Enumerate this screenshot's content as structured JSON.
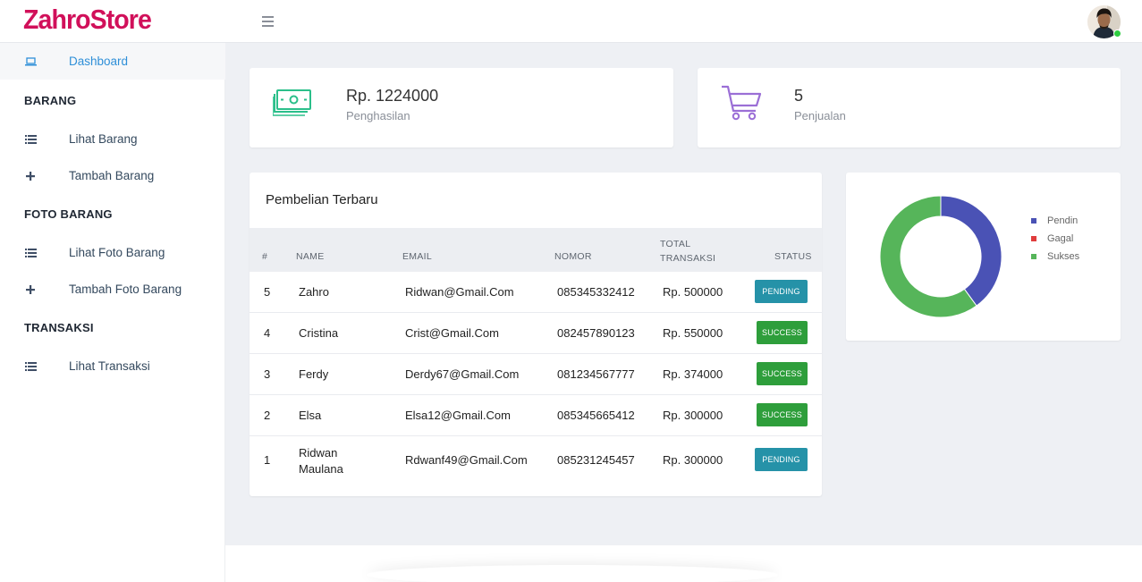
{
  "header": {
    "brand": "ZahroStore",
    "menu_icon": "hamburger-icon",
    "avatar_icon": "user-avatar"
  },
  "sidebar": {
    "dashboard": {
      "label": "Dashboard",
      "icon": "laptop-icon"
    },
    "sections": [
      {
        "title": "BARANG",
        "items": [
          {
            "label": "Lihat Barang",
            "icon": "list-icon"
          },
          {
            "label": "Tambah Barang",
            "icon": "plus-icon"
          }
        ]
      },
      {
        "title": "FOTO BARANG",
        "items": [
          {
            "label": "Lihat Foto Barang",
            "icon": "list-icon"
          },
          {
            "label": "Tambah Foto Barang",
            "icon": "plus-icon"
          }
        ]
      },
      {
        "title": "TRANSAKSI",
        "items": [
          {
            "label": "Lihat Transaksi",
            "icon": "list-icon"
          }
        ]
      }
    ]
  },
  "stats": {
    "income": {
      "value": "Rp. 1224000",
      "label": "Penghasilan",
      "icon": "money-icon",
      "color": "#2bbf8a"
    },
    "sales": {
      "value": "5",
      "label": "Penjualan",
      "icon": "cart-icon",
      "color": "#9b6fd6"
    }
  },
  "purchases": {
    "title": "Pembelian Terbaru",
    "columns": [
      "#",
      "NAME",
      "EMAIL",
      "NOMOR",
      "TOTAL TRANSAKSI",
      "STATUS"
    ],
    "rows": [
      {
        "no": "5",
        "name": "Zahro",
        "email": "Ridwan@Gmail.Com",
        "phone": "085345332412",
        "total": "Rp. 500000",
        "status": "PENDING"
      },
      {
        "no": "4",
        "name": "Cristina",
        "email": "Crist@Gmail.Com",
        "phone": "082457890123",
        "total": "Rp. 550000",
        "status": "SUCCESS"
      },
      {
        "no": "3",
        "name": "Ferdy",
        "email": "Derdy67@Gmail.Com",
        "phone": "081234567777",
        "total": "Rp. 374000",
        "status": "SUCCESS"
      },
      {
        "no": "2",
        "name": "Elsa",
        "email": "Elsa12@Gmail.Com",
        "phone": "085345665412",
        "total": "Rp. 300000",
        "status": "SUCCESS"
      },
      {
        "no": "1",
        "name": "Ridwan Maulana",
        "email": "Rdwanf49@Gmail.Com",
        "phone": "085231245457",
        "total": "Rp. 300000",
        "status": "PENDING"
      }
    ],
    "status_colors": {
      "PENDING": "#2592a8",
      "SUCCESS": "#2e9e3b"
    }
  },
  "chart_data": {
    "type": "pie",
    "variant": "doughnut",
    "legend_position": "right",
    "categories": [
      "Pendin",
      "Gagal",
      "Sukses"
    ],
    "values": [
      2,
      0,
      3
    ],
    "colors": [
      "#4a52b5",
      "#e03c3c",
      "#56b55a"
    ]
  }
}
